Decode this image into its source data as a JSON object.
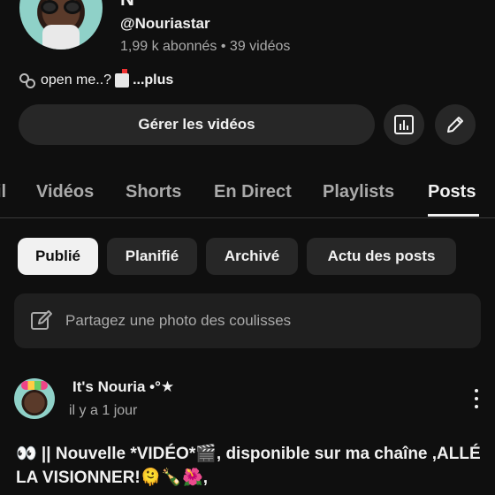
{
  "channel": {
    "name": "N",
    "handle": "@Nouriastar",
    "stats": "1,99 k abonnés • 39 vidéos",
    "bio": "open me..?",
    "bio_more": "...plus"
  },
  "actions": {
    "manage_videos": "Gérer les vidéos",
    "analytics_icon": "bar-chart-icon",
    "edit_icon": "pencil-icon"
  },
  "tabs": [
    {
      "label": "il"
    },
    {
      "label": "Vidéos"
    },
    {
      "label": "Shorts"
    },
    {
      "label": "En Direct"
    },
    {
      "label": "Playlists"
    },
    {
      "label": "Posts",
      "active": true
    }
  ],
  "filters": [
    {
      "label": "Publié",
      "active": true
    },
    {
      "label": "Planifié"
    },
    {
      "label": "Archivé"
    },
    {
      "label": "Actu des posts"
    }
  ],
  "composer": {
    "placeholder": "Partagez une photo des coulisses"
  },
  "post": {
    "author": "It's Nouria •°★",
    "time": "il y a 1 jour",
    "text": "👀 || Nouvelle *VIDÉO*🎬, disponible sur ma chaîne ,ALLÉ LA VISIONNER!🫠🍾🌺,"
  },
  "colors": {
    "background": "#0f0f0f",
    "surface": "#272727",
    "text": "#f1f1f1",
    "muted": "#aaaaaa"
  }
}
